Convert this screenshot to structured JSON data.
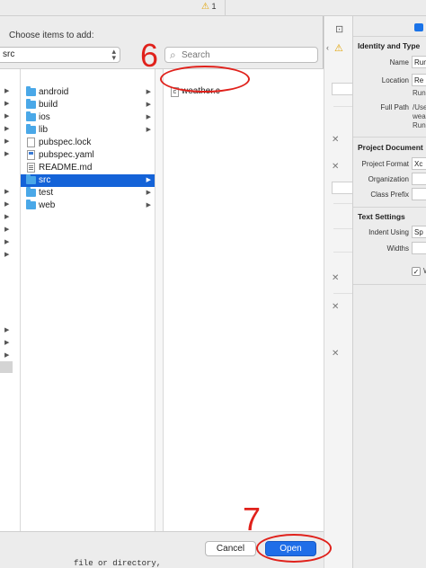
{
  "toolbar": {
    "warning_icon": "warning-triangle-icon",
    "warning_count": "1"
  },
  "sheet": {
    "title": "Choose items to add:",
    "location_value": "src",
    "search_placeholder": "Search"
  },
  "browser": {
    "column1_items": [
      {
        "label": "android",
        "icon": "folder-icon",
        "has_children": true,
        "selected": false
      },
      {
        "label": "build",
        "icon": "folder-icon",
        "has_children": true,
        "selected": false
      },
      {
        "label": "ios",
        "icon": "folder-icon",
        "has_children": true,
        "selected": false
      },
      {
        "label": "lib",
        "icon": "folder-icon",
        "has_children": true,
        "selected": false
      },
      {
        "label": "pubspec.lock",
        "icon": "file-icon",
        "has_children": false,
        "selected": false
      },
      {
        "label": "pubspec.yaml",
        "icon": "file-icon",
        "has_children": false,
        "selected": false
      },
      {
        "label": "README.md",
        "icon": "document-icon",
        "has_children": false,
        "selected": false
      },
      {
        "label": "src",
        "icon": "folder-icon",
        "has_children": true,
        "selected": true
      },
      {
        "label": "test",
        "icon": "folder-icon",
        "has_children": true,
        "selected": false
      },
      {
        "label": "web",
        "icon": "folder-icon",
        "has_children": true,
        "selected": false
      }
    ],
    "column3_items": [
      {
        "label": "weather.c",
        "icon": "c-file-icon",
        "icon_letter": "c"
      }
    ]
  },
  "annotations": {
    "step6": "6",
    "step7": "7",
    "color": "#e0211b"
  },
  "buttons": {
    "cancel": "Cancel",
    "open": "Open"
  },
  "inspector": {
    "identity_header": "Identity and Type",
    "name_label": "Name",
    "name_value": "Run",
    "location_label": "Location",
    "location_value": "Re",
    "location_sub": "Run",
    "full_path_label": "Full Path",
    "full_path_lines": [
      "/Use",
      "wea",
      "Run"
    ],
    "project_header": "Project Document",
    "project_format_label": "Project Format",
    "project_format_value": "Xc",
    "organization_label": "Organization",
    "class_prefix_label": "Class Prefix",
    "text_header": "Text Settings",
    "indent_label": "Indent Using",
    "indent_value": "Sp",
    "widths_label": "Widths",
    "wrap_label": "W"
  },
  "code_peek": "file or directory,"
}
